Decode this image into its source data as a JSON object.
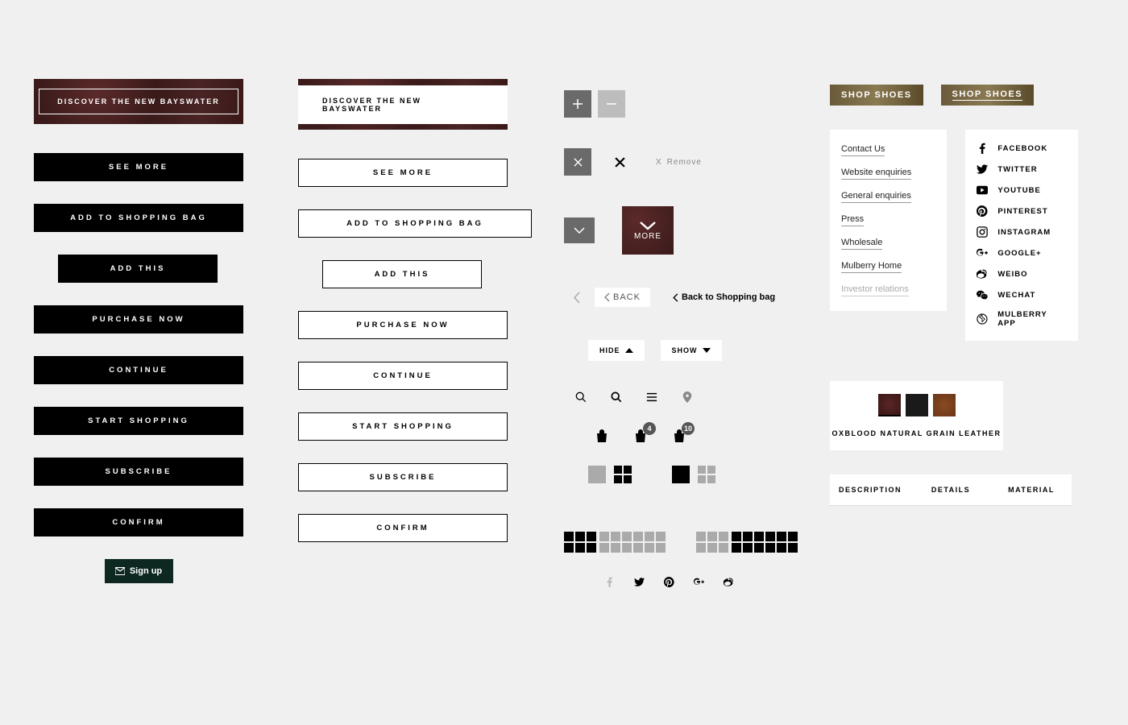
{
  "hero": {
    "outline_label": "DISCOVER THE NEW BAYSWATER",
    "solid_label": "DISCOVER THE NEW BAYSWATER"
  },
  "primary_buttons": [
    "SEE MORE",
    "ADD TO SHOPPING BAG",
    "ADD THIS",
    "PURCHASE NOW",
    "CONTINUE",
    "START SHOPPING",
    "SUBSCRIBE",
    "CONFIRM"
  ],
  "secondary_buttons": [
    "SEE MORE",
    "ADD TO SHOPPING BAG",
    "ADD THIS",
    "PURCHASE NOW",
    "CONTINUE",
    "START SHOPPING",
    "SUBSCRIBE",
    "CONFIRM"
  ],
  "signup_label": "Sign up",
  "remove_label": "Remove",
  "more_label": "MORE",
  "back_label": "BACK",
  "back_long": "Back to Shopping bag",
  "hide_label": "HIDE",
  "show_label": "SHOW",
  "shop_label_a": "SHOP SHOES",
  "shop_label_b": "SHOP SHOES",
  "footer_links": [
    "Contact Us",
    "Website enquiries",
    "General enquiries",
    "Press",
    "Wholesale",
    "Mulberry Home",
    "Investor relations"
  ],
  "social": [
    "FACEBOOK",
    "TWITTER",
    "YOUTUBE",
    "PINTEREST",
    "INSTAGRAM",
    "GOOGLE+",
    "WEIBO",
    "WECHAT",
    "MULBERRY APP"
  ],
  "swatch_label": "OXBLOOD NATURAL GRAIN LEATHER",
  "bag_badges": [
    "4",
    "10"
  ],
  "tabs": [
    "DESCRIPTION",
    "DETAILS",
    "MATERIAL"
  ]
}
